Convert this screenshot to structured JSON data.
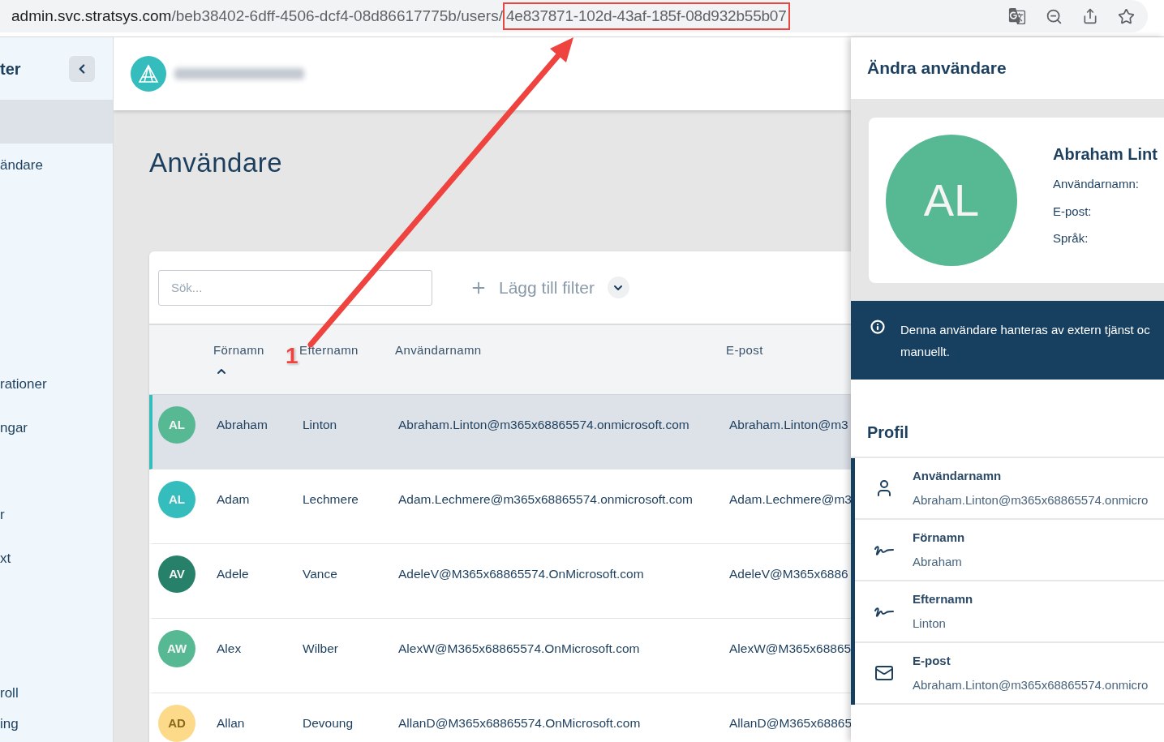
{
  "browser": {
    "url_domain": "admin.svc.stratsys.com",
    "url_path": "/beb38402-6dff-4506-dcf4-08d86617775b/users/",
    "url_highlight": "4e837871-102d-43af-185f-08d932b55b07"
  },
  "sidebar": {
    "title": "ter",
    "items": [
      {
        "label": "ändare"
      },
      {
        "label": "rationer"
      },
      {
        "label": "ngar"
      },
      {
        "label": "r"
      },
      {
        "label": "xt"
      },
      {
        "label": "roll"
      },
      {
        "label": "ing"
      }
    ]
  },
  "page": {
    "title": "Användare",
    "search": {
      "placeholder": "Sök..."
    },
    "filter_button": "Lägg till filter"
  },
  "table": {
    "columns": [
      {
        "label": "Förnamn",
        "sorted": true
      },
      {
        "label": "Efternamn",
        "sorted": false
      },
      {
        "label": "Användarnamn",
        "sorted": false
      },
      {
        "label": "E-post",
        "sorted": false
      }
    ],
    "rows": [
      {
        "initials": "AL",
        "color": "#57b894",
        "first": "Abraham",
        "last": "Linton",
        "username": "Abraham.Linton@m365x68865574.onmicrosoft.com",
        "email": "Abraham.Linton@m3",
        "selected": true
      },
      {
        "initials": "AL",
        "color": "#35bcbc",
        "first": "Adam",
        "last": "Lechmere",
        "username": "Adam.Lechmere@m365x68865574.onmicrosoft.com",
        "email": "Adam.Lechmere@m3",
        "selected": false
      },
      {
        "initials": "AV",
        "color": "#26806a",
        "first": "Adele",
        "last": "Vance",
        "username": "AdeleV@M365x68865574.OnMicrosoft.com",
        "email": "AdeleV@M365x6886",
        "selected": false
      },
      {
        "initials": "AW",
        "color": "#57b894",
        "first": "Alex",
        "last": "Wilber",
        "username": "AlexW@M365x68865574.OnMicrosoft.com",
        "email": "AlexW@M365x68865",
        "selected": false
      },
      {
        "initials": "AD",
        "color": "#fdd98a",
        "first": "Allan",
        "last": "Devoung",
        "username": "AllanD@M365x68865574.OnMicrosoft.com",
        "email": "AllanD@M365x68865",
        "selected": false
      }
    ]
  },
  "panel": {
    "title": "Ändra användare",
    "profile_card": {
      "initials": "AL",
      "color": "#57b894",
      "name": "Abraham Lint",
      "labels": [
        "Användarnamn:",
        "E-post:",
        "Språk:"
      ]
    },
    "info": [
      "Denna användare hanteras av extern tjänst oc",
      "manuellt."
    ],
    "section_title": "Profil",
    "fields": [
      {
        "kind": "user",
        "label": "Användarnamn",
        "value": "Abraham.Linton@m365x68865574.onmicro"
      },
      {
        "kind": "signature",
        "label": "Förnamn",
        "value": "Abraham"
      },
      {
        "kind": "signature",
        "label": "Efternamn",
        "value": "Linton"
      },
      {
        "kind": "mail",
        "label": "E-post",
        "value": "Abraham.Linton@m365x68865574.onmicro"
      }
    ]
  },
  "annotation": {
    "label": "1"
  }
}
